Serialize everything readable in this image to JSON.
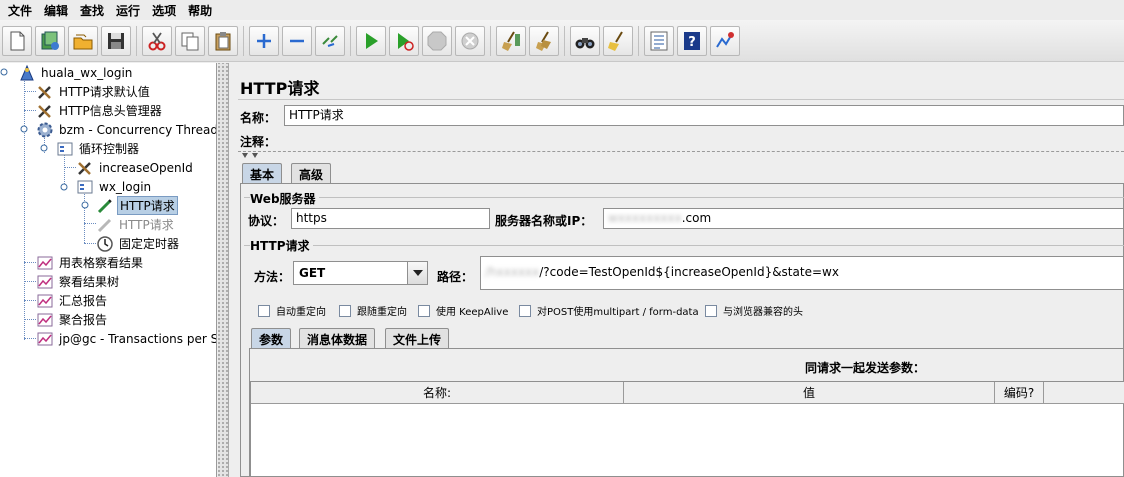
{
  "menu": [
    "文件",
    "编辑",
    "查找",
    "运行",
    "选项",
    "帮助"
  ],
  "toolbar": {
    "icons": [
      "new-icon",
      "templates-icon",
      "open-icon",
      "save-icon",
      "cut-icon",
      "copy-icon",
      "paste-icon",
      "expand-icon",
      "collapse-icon",
      "toggle-icon",
      "start-icon",
      "start-no-pause-icon",
      "stop-icon",
      "shutdown-icon",
      "clear-icon",
      "clear-all-icon",
      "search-icon",
      "reset-search-icon",
      "function-helper-icon",
      "help-icon",
      "remote-icon"
    ]
  },
  "tree": {
    "items": [
      {
        "label": "huala_wx_login"
      },
      {
        "label": "HTTP请求默认值"
      },
      {
        "label": "HTTP信息头管理器"
      },
      {
        "label": "bzm - Concurrency Thread Group"
      },
      {
        "label": "循环控制器"
      },
      {
        "label": "increaseOpenId"
      },
      {
        "label": "wx_login"
      },
      {
        "label": "HTTP请求",
        "selected": true
      },
      {
        "label": "HTTP请求",
        "disabled": true
      },
      {
        "label": "固定定时器"
      },
      {
        "label": "用表格察看结果"
      },
      {
        "label": "察看结果树"
      },
      {
        "label": "汇总报告"
      },
      {
        "label": "聚合报告"
      },
      {
        "label": "jp@gc - Transactions per Second"
      }
    ]
  },
  "panel": {
    "title": "HTTP请求",
    "name_label": "名称：",
    "name_value": "HTTP请求",
    "comment_label": "注释：",
    "comment_value": "",
    "tabs": [
      "基本",
      "高级"
    ],
    "web_server_title": "Web服务器",
    "protocol_label": "协议：",
    "protocol_value": "https",
    "server_label": "服务器名称或IP：",
    "server_hidden": "wxxxxxxxxx",
    "server_suffix": ".com",
    "http_request_title": "HTTP请求",
    "method_label": "方法：",
    "method_value": "GET",
    "path_label": "路径：",
    "path_hidden": "/hxxxxxx",
    "path_suffix": "/?code=TestOpenId${increaseOpenId}&state=wx",
    "checkboxes": [
      "自动重定向",
      "跟随重定向",
      "使用 KeepAlive",
      "对POST使用multipart / form-data",
      "与浏览器兼容的头"
    ],
    "subtabs": [
      "参数",
      "消息体数据",
      "文件上传"
    ],
    "params_heading": "同请求一起发送参数：",
    "columns": [
      "名称:",
      "值",
      "编码?"
    ]
  }
}
